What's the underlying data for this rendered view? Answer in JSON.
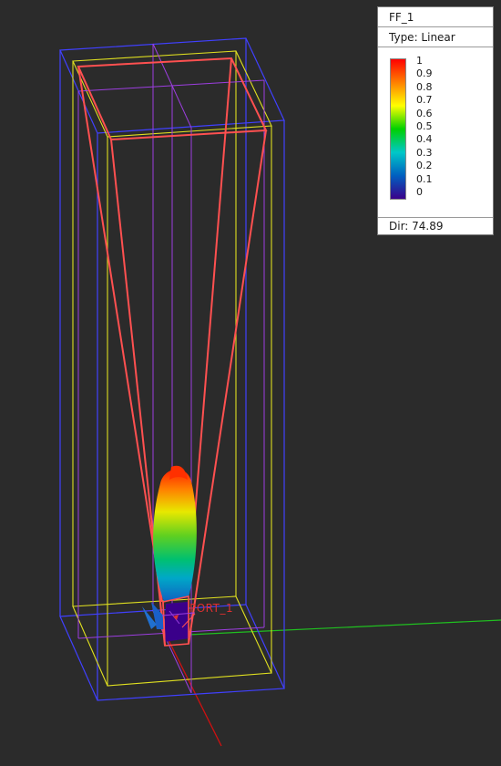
{
  "legend": {
    "title": "FF_1",
    "type": "Type: Linear",
    "ticks": [
      "1",
      "0.9",
      "0.8",
      "0.7",
      "0.6",
      "0.5",
      "0.4",
      "0.3",
      "0.2",
      "0.1",
      "0"
    ],
    "directivity": "Dir: 74.89",
    "gradient": [
      "#ff0000",
      "#ff8000",
      "#ffff00",
      "#00d000",
      "#00c8c8",
      "#0060c0",
      "#3a008a"
    ]
  },
  "scene": {
    "port_label": "PORT_1",
    "colors": {
      "background": "#2b2b2b",
      "bounding_box": "#4040ff",
      "inner_box": "#e0e020",
      "horn": "#ff5050",
      "mid_lines": "#9d3ee0",
      "x_axis": "#d01010",
      "y_axis": "#20c020"
    }
  }
}
